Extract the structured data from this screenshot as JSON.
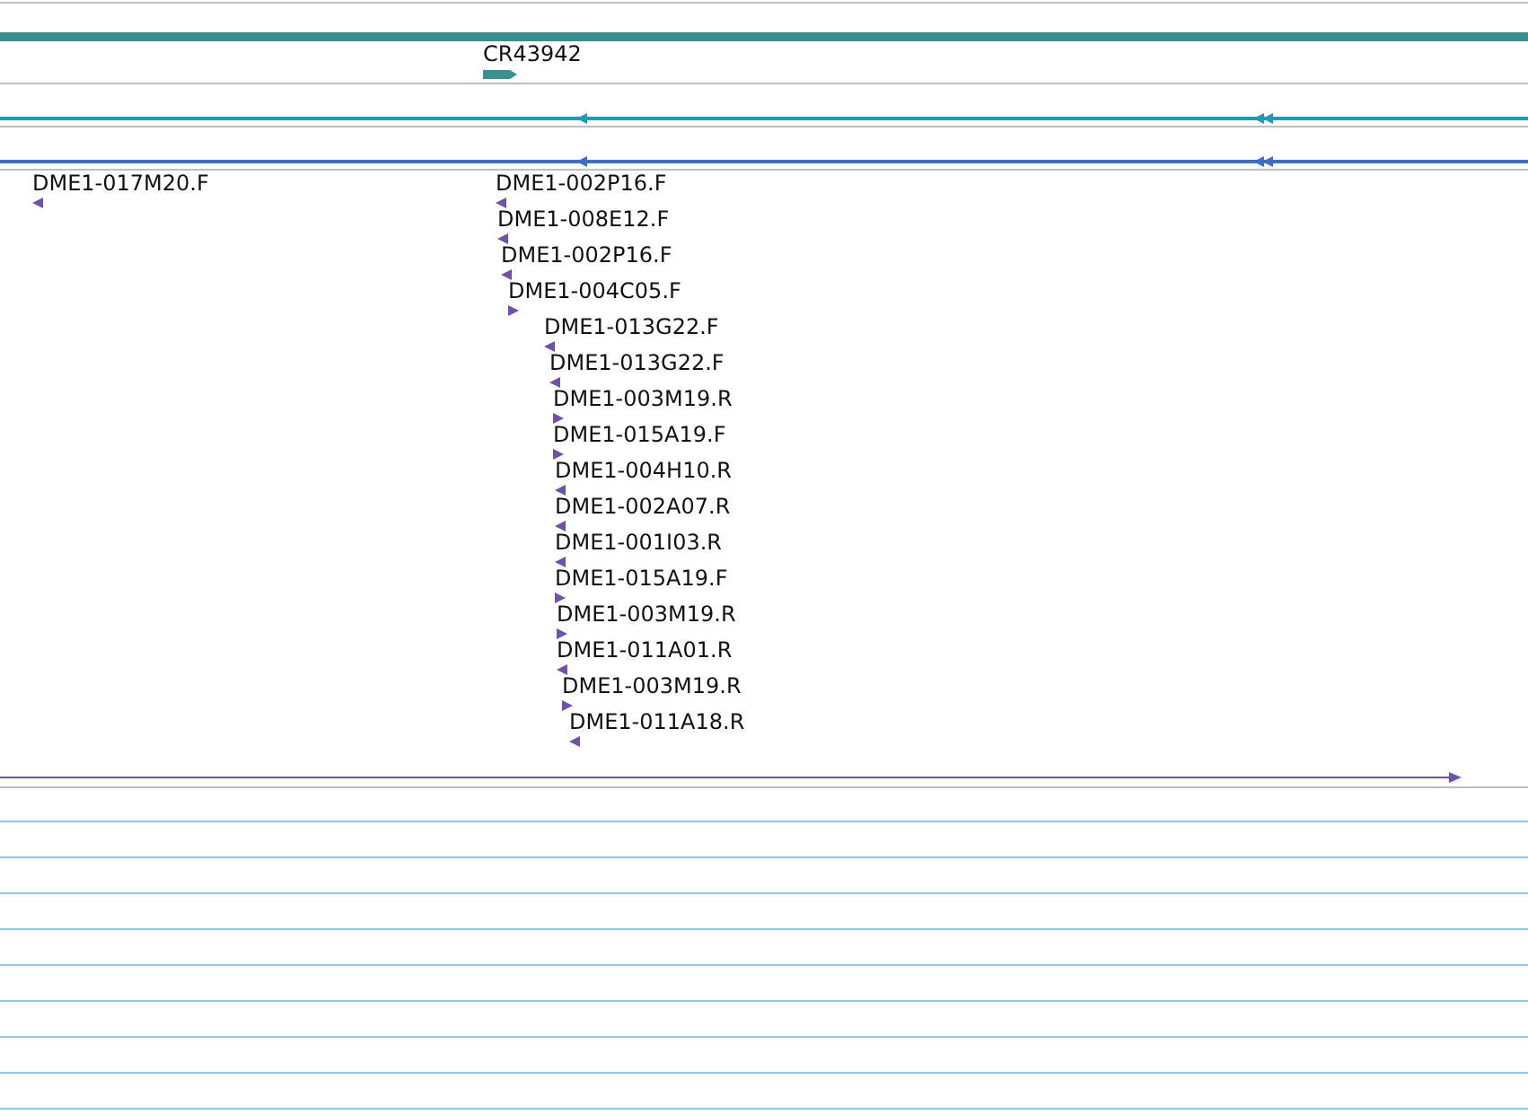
{
  "gene_track": {
    "features": [
      {
        "label": "CR43942",
        "reverse": false
      }
    ]
  },
  "transcript_tracks": [
    {
      "color": "#1a9bb8"
    },
    {
      "color": "#3a6fd0"
    }
  ],
  "read_track": {
    "features": [
      {
        "label": "DME1-017M20.F",
        "reverse": true
      },
      {
        "label": "DME1-002P16.F",
        "reverse": true
      },
      {
        "label": "DME1-008E12.F",
        "reverse": true
      },
      {
        "label": "DME1-002P16.F",
        "reverse": true
      },
      {
        "label": "DME1-004C05.F",
        "reverse": false
      },
      {
        "label": "DME1-013G22.F",
        "reverse": true
      },
      {
        "label": "DME1-013G22.F",
        "reverse": true
      },
      {
        "label": "DME1-003M19.R",
        "reverse": false
      },
      {
        "label": "DME1-015A19.F",
        "reverse": false
      },
      {
        "label": "DME1-004H10.R",
        "reverse": true
      },
      {
        "label": "DME1-002A07.R",
        "reverse": true
      },
      {
        "label": "DME1-001I03.R",
        "reverse": true
      },
      {
        "label": "DME1-015A19.F",
        "reverse": false
      },
      {
        "label": "DME1-003M19.R",
        "reverse": false
      },
      {
        "label": "DME1-011A01.R",
        "reverse": true
      },
      {
        "label": "DME1-003M19.R",
        "reverse": false
      },
      {
        "label": "DME1-011A18.R",
        "reverse": true
      }
    ]
  }
}
